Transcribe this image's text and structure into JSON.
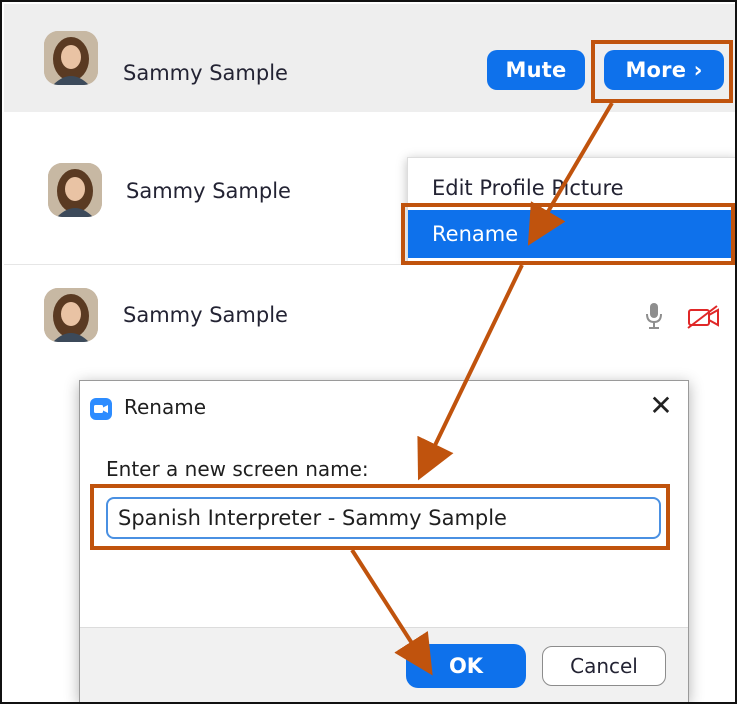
{
  "participants": [
    {
      "name": "Sammy Sample",
      "avatar_icon": "participant-avatar-photo"
    },
    {
      "name": "Sammy Sample",
      "avatar_icon": "participant-avatar-photo"
    },
    {
      "name": "Sammy Sample",
      "avatar_icon": "participant-avatar-photo"
    }
  ],
  "row_actions": {
    "mute_label": "Mute",
    "more_label": "More ›"
  },
  "context_menu": {
    "items": [
      "Edit Profile Picture",
      "Rename"
    ],
    "selected": "Rename"
  },
  "status_icons": [
    "microphone-icon",
    "video-off-icon"
  ],
  "dialog": {
    "title": "Rename",
    "prompt": "Enter a new screen name:",
    "input_value": "Spanish Interpreter - Sammy Sample",
    "ok_label": "OK",
    "cancel_label": "Cancel",
    "close_glyph": "✕"
  },
  "colors": {
    "accent_blue": "#0e71eb",
    "callout_orange": "#c0530d",
    "video_off_red": "#e02828"
  }
}
